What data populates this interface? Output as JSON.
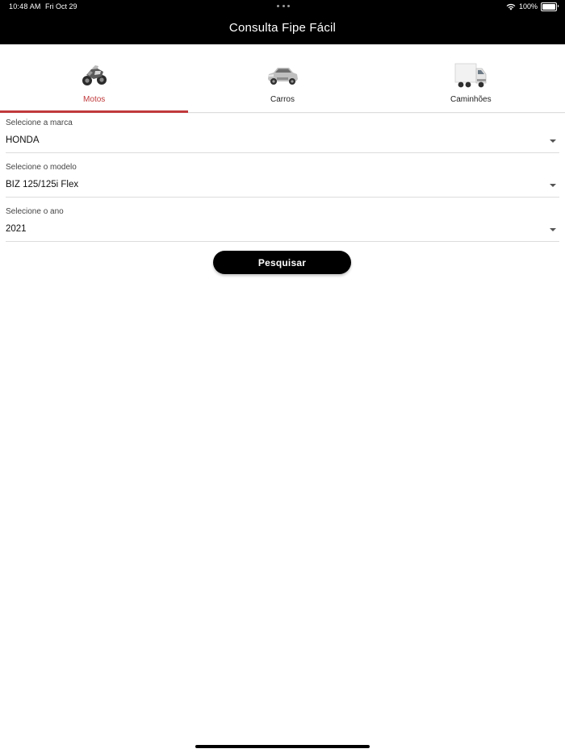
{
  "status_bar": {
    "time": "10:48 AM",
    "date": "Fri Oct 29",
    "battery": "100%",
    "icons": [
      "wifi-icon",
      "battery-icon"
    ]
  },
  "header": {
    "title": "Consulta Fipe Fácil",
    "background": "#000000"
  },
  "tabs": [
    {
      "label": "Motos",
      "icon": "motorcycle-icon",
      "active": true
    },
    {
      "label": "Carros",
      "icon": "car-icon",
      "active": false
    },
    {
      "label": "Caminhões",
      "icon": "truck-icon",
      "active": false
    }
  ],
  "accent_color": "#c0393b",
  "form": {
    "brand": {
      "label": "Selecione a marca",
      "value": "HONDA"
    },
    "model": {
      "label": "Selecione o modelo",
      "value": "BIZ 125/125i Flex"
    },
    "year": {
      "label": "Selecione o ano",
      "value": "2021"
    },
    "search_label": "Pesquisar"
  }
}
